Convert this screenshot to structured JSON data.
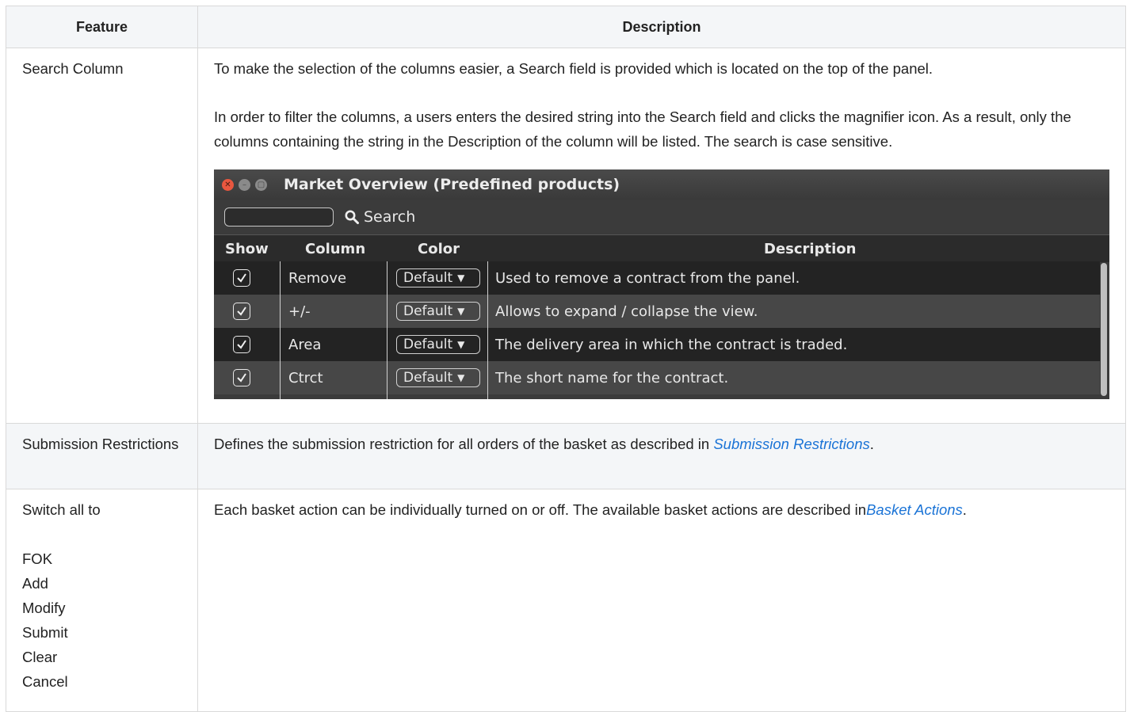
{
  "table": {
    "headers": {
      "feature": "Feature",
      "description": "Description"
    },
    "rows": [
      {
        "feature": "Search Column",
        "paragraphs": [
          "To make the selection of the columns easier, a Search field is provided which is located on the top of the panel.",
          "In order to filter the columns, a users enters the desired string into the Search field and clicks the magnifier icon. As a result, only the columns containing the string in the Description of the column will be listed. The search is case sensitive."
        ]
      },
      {
        "feature": "Submission Restrictions",
        "text_before": "Defines the submission restriction for all orders of the basket as described in ",
        "link": "Submission Restrictions",
        "text_after": "."
      },
      {
        "feature": "Switch all to",
        "actions": [
          "FOK",
          "Add",
          "Modify",
          "Submit",
          "Clear",
          "Cancel"
        ],
        "text_before": "Each basket action can be individually turned on or off. The available basket actions are described in",
        "link": "Basket Actions",
        "text_after": "."
      }
    ]
  },
  "window": {
    "title": "Market Overview (Predefined products)",
    "search_label": "Search",
    "search_value": "",
    "columns": {
      "show": "Show",
      "column": "Column",
      "color": "Color",
      "description": "Description"
    },
    "rows": [
      {
        "checked": true,
        "column": "Remove",
        "color": "Default",
        "description": "Used to remove a contract from the panel."
      },
      {
        "checked": true,
        "column": "+/-",
        "color": "Default",
        "description": "Allows to expand / collapse the view."
      },
      {
        "checked": true,
        "column": "Area",
        "color": "Default",
        "description": "The delivery area in which the contract is traded."
      },
      {
        "checked": true,
        "column": "Ctrct",
        "color": "Default",
        "description": "The short name for the contract."
      }
    ]
  }
}
